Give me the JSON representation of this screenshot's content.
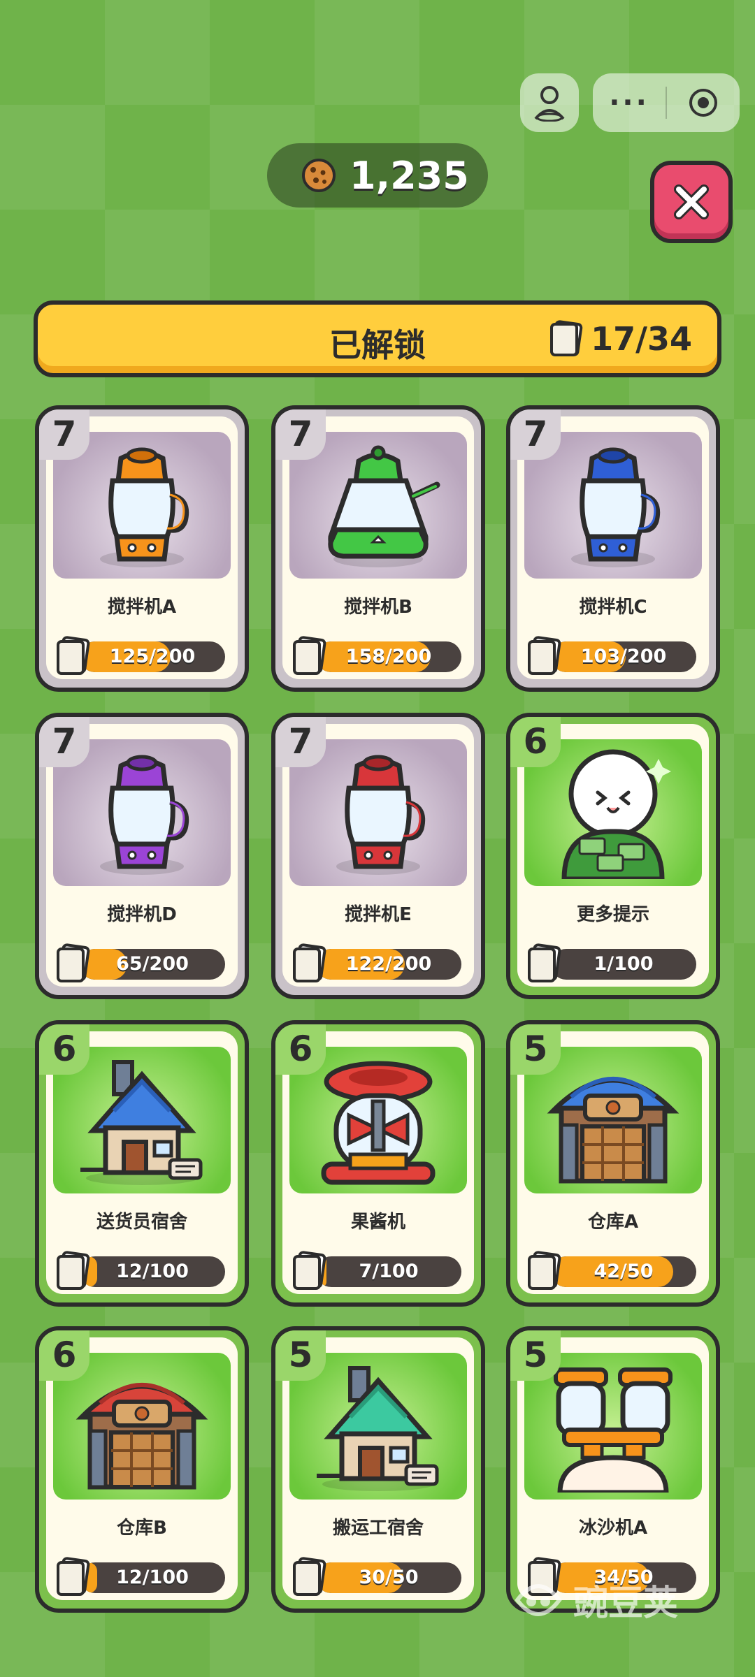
{
  "header": {
    "coins": "1,235",
    "more_label": "···"
  },
  "banner": {
    "title": "已解锁",
    "count": "17/34"
  },
  "cards": [
    {
      "level": "7",
      "name": "搅拌机A",
      "progress_text": "125/200",
      "progress": 0.625,
      "style": "gray",
      "art": "blender-orange-icon"
    },
    {
      "level": "7",
      "name": "搅拌机B",
      "progress_text": "158/200",
      "progress": 0.79,
      "style": "gray",
      "art": "kettle-green-icon"
    },
    {
      "level": "7",
      "name": "搅拌机C",
      "progress_text": "103/200",
      "progress": 0.515,
      "style": "gray",
      "art": "blender-blue-icon"
    },
    {
      "level": "7",
      "name": "搅拌机D",
      "progress_text": "65/200",
      "progress": 0.325,
      "style": "gray",
      "art": "blender-purple-icon"
    },
    {
      "level": "7",
      "name": "搅拌机E",
      "progress_text": "122/200",
      "progress": 0.61,
      "style": "gray",
      "art": "blender-red-icon"
    },
    {
      "level": "6",
      "name": "更多提示",
      "progress_text": "1/100",
      "progress": 0.01,
      "style": "green",
      "art": "money-ghost-icon"
    },
    {
      "level": "6",
      "name": "送货员宿舍",
      "progress_text": "12/100",
      "progress": 0.12,
      "style": "green",
      "art": "house-blue-icon"
    },
    {
      "level": "6",
      "name": "果酱机",
      "progress_text": "7/100",
      "progress": 0.07,
      "style": "green",
      "art": "jam-machine-icon"
    },
    {
      "level": "5",
      "name": "仓库A",
      "progress_text": "42/50",
      "progress": 0.84,
      "style": "green",
      "art": "warehouse-blue-icon"
    },
    {
      "level": "6",
      "name": "仓库B",
      "progress_text": "12/100",
      "progress": 0.12,
      "style": "green",
      "art": "warehouse-red-icon"
    },
    {
      "level": "5",
      "name": "搬运工宿舍",
      "progress_text": "30/50",
      "progress": 0.6,
      "style": "green",
      "art": "house-teal-icon"
    },
    {
      "level": "5",
      "name": "冰沙机A",
      "progress_text": "34/50",
      "progress": 0.68,
      "style": "green",
      "art": "slush-machine-icon"
    }
  ],
  "watermark": "豌豆荚",
  "colors": {
    "background": "#6fb34a",
    "banner": "#ffce3d",
    "close": "#e94c6e",
    "progress_fill": "#f7a21b"
  }
}
